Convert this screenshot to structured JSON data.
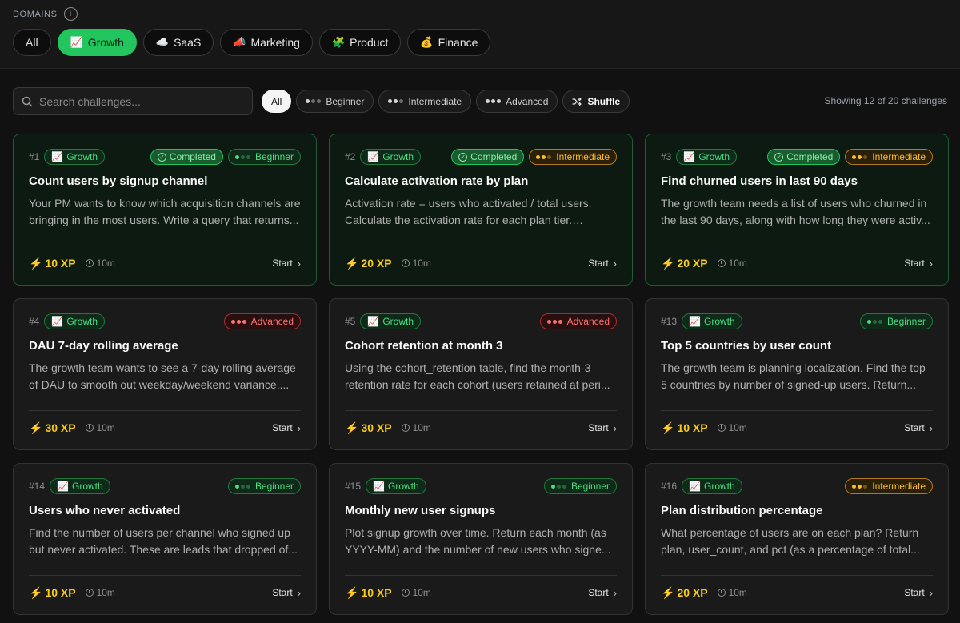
{
  "domains": {
    "label": "DOMAINS",
    "info_icon": "i",
    "items": [
      {
        "label": "All",
        "emoji": "",
        "active": false
      },
      {
        "label": "Growth",
        "emoji": "📈",
        "active": true
      },
      {
        "label": "SaaS",
        "emoji": "☁️",
        "active": false
      },
      {
        "label": "Marketing",
        "emoji": "📣",
        "active": false
      },
      {
        "label": "Product",
        "emoji": "🧩",
        "active": false
      },
      {
        "label": "Finance",
        "emoji": "💰",
        "active": false
      }
    ]
  },
  "filters": {
    "search_placeholder": "Search challenges...",
    "levels": [
      {
        "label": "All",
        "dots": 0,
        "active": true
      },
      {
        "label": "Beginner",
        "dots": 1
      },
      {
        "label": "Intermediate",
        "dots": 2
      },
      {
        "label": "Advanced",
        "dots": 3
      }
    ],
    "shuffle_label": "Shuffle",
    "showing_text": "Showing 12 of 20 challenges"
  },
  "completed_label": "Completed",
  "start_label": "Start",
  "domain_badge": {
    "emoji": "📈",
    "label": "Growth"
  },
  "challenges": [
    {
      "num": "#1",
      "title": "Count users by signup channel",
      "desc": "Your PM wants to know which acquisition channels are bringing in the most users. Write a query that returns...",
      "level": "Beginner",
      "completed": true,
      "xp": "10 XP",
      "time": "10m"
    },
    {
      "num": "#2",
      "title": "Calculate activation rate by plan",
      "desc": "Activation rate = users who activated / total users. Calculate the activation rate for each plan tier. Return...",
      "level": "Intermediate",
      "completed": true,
      "xp": "20 XP",
      "time": "10m"
    },
    {
      "num": "#3",
      "title": "Find churned users in last 90 days",
      "desc": "The growth team needs a list of users who churned in the last 90 days, along with how long they were activ...",
      "level": "Intermediate",
      "completed": true,
      "xp": "20 XP",
      "time": "10m"
    },
    {
      "num": "#4",
      "title": "DAU 7-day rolling average",
      "desc": "The growth team wants to see a 7-day rolling average of DAU to smooth out weekday/weekend variance....",
      "level": "Advanced",
      "completed": false,
      "xp": "30 XP",
      "time": "10m"
    },
    {
      "num": "#5",
      "title": "Cohort retention at month 3",
      "desc": "Using the cohort_retention table, find the month-3 retention rate for each cohort (users retained at peri...",
      "level": "Advanced",
      "completed": false,
      "xp": "30 XP",
      "time": "10m"
    },
    {
      "num": "#13",
      "title": "Top 5 countries by user count",
      "desc": "The growth team is planning localization. Find the top 5 countries by number of signed-up users. Return...",
      "level": "Beginner",
      "completed": false,
      "xp": "10 XP",
      "time": "10m"
    },
    {
      "num": "#14",
      "title": "Users who never activated",
      "desc": "Find the number of users per channel who signed up but never activated. These are leads that dropped of...",
      "level": "Beginner",
      "completed": false,
      "xp": "10 XP",
      "time": "10m"
    },
    {
      "num": "#15",
      "title": "Monthly new user signups",
      "desc": "Plot signup growth over time. Return each month (as YYYY-MM) and the number of new users who signe...",
      "level": "Beginner",
      "completed": false,
      "xp": "10 XP",
      "time": "10m"
    },
    {
      "num": "#16",
      "title": "Plan distribution percentage",
      "desc": "What percentage of users are on each plan? Return plan, user_count, and pct (as a percentage of total...",
      "level": "Intermediate",
      "completed": false,
      "xp": "20 XP",
      "time": "10m"
    }
  ],
  "colors": {
    "accent": "#22c55e",
    "beginner": "#4ade80",
    "intermediate": "#fbbf24",
    "advanced": "#f87171",
    "xp": "#facc15"
  }
}
